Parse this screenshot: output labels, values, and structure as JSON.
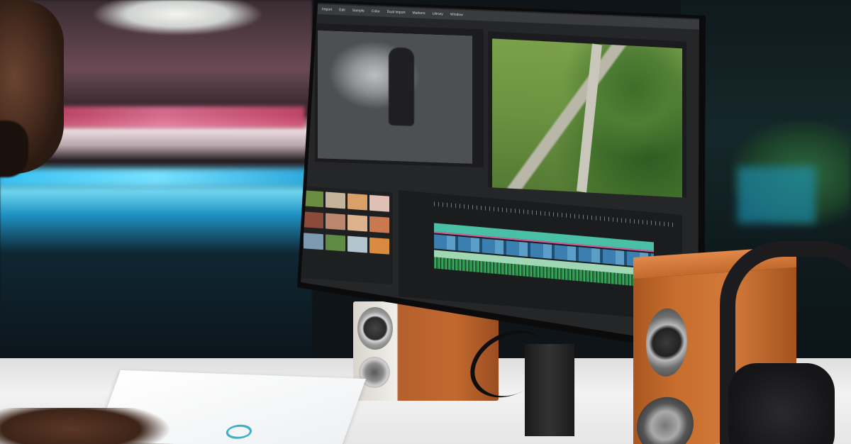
{
  "scene": {
    "description_label": ""
  },
  "editor": {
    "menu": [
      "Import",
      "Edit",
      "Sample",
      "Color",
      "Dual Import",
      "Markers",
      "Library",
      "Window"
    ],
    "source_label": "",
    "program_label": "",
    "tracks": [
      "",
      "",
      ""
    ],
    "colors": {
      "track_audio": "#44b865",
      "track_video": "#3a7fb0",
      "track_title": "#49c0a6",
      "marker": "#d65aa2"
    }
  }
}
